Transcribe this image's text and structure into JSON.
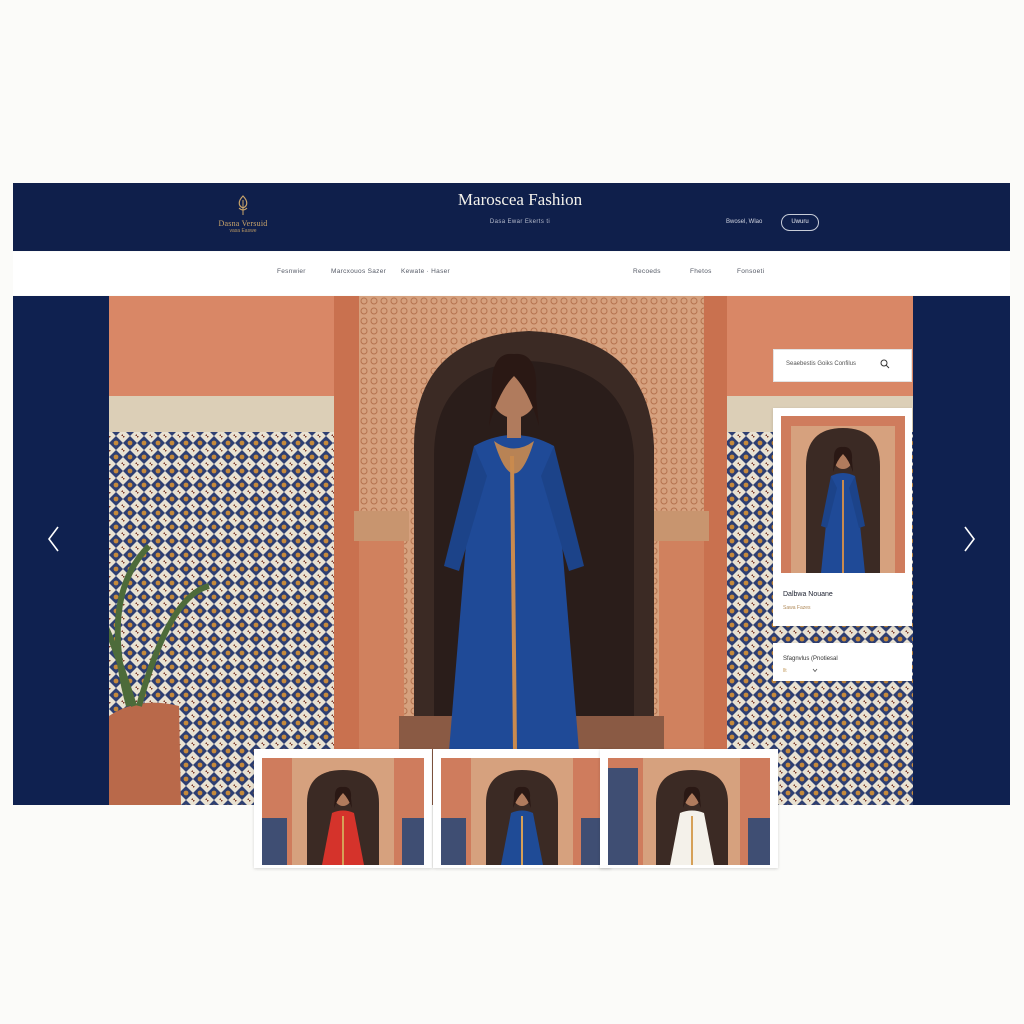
{
  "header": {
    "logo_name": "Dasna Versuid",
    "logo_sub": "vasa Easwe",
    "title": "Maroscea Fashion",
    "tagline": "Dasa Ewar Ekerts ti",
    "link": "Bwosel, Wlao",
    "button": "Uwuru"
  },
  "nav": {
    "items": [
      "Fesnwier",
      "Marcxouos Sazer",
      "Kewate · Haser",
      "Recoeds",
      "Fhetos",
      "Fonsoeti"
    ]
  },
  "search": {
    "placeholder": "Seaebestis Goiks Confilus"
  },
  "product_card": {
    "title": "Dalbwa Nouane",
    "subtitle": "Sawa Fazes"
  },
  "options_panel": {
    "label": "Sfagnvlus (Pnotiesal",
    "value": "llt"
  },
  "hero": {
    "dress_color": "#1f4a97"
  },
  "thumbnails": [
    {
      "dress_color": "#d5332b"
    },
    {
      "dress_color": "#1f4b96"
    },
    {
      "dress_color": "#f4f1ea"
    }
  ],
  "icons": [
    "logo-icon",
    "search-icon",
    "chevron-left-icon",
    "chevron-right-icon",
    "chevron-down-icon"
  ],
  "colors": {
    "navy": "#0f1f4b",
    "gold": "#c9a46a",
    "terracotta": "#cf7c5d"
  }
}
